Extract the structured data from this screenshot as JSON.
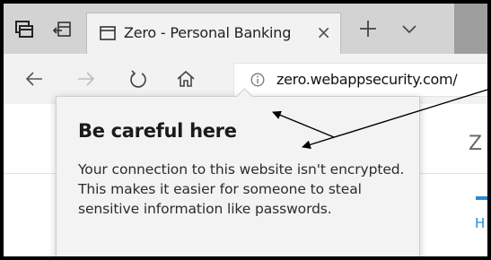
{
  "tab": {
    "title": "Zero - Personal Banking",
    "close_glyph": "×"
  },
  "address_bar": {
    "url": "zero.webappsecurity.com/"
  },
  "popover": {
    "title": "Be careful here",
    "body": "Your connection to this website isn't encrypted. This makes it easier for someone to steal sensitive information like passwords."
  },
  "page": {
    "heading_fragment": "Z",
    "link_fragment": "H"
  },
  "icons": {
    "tab_actions": "tab-actions-icon",
    "set_aside_tabs": "set-aside-tabs-icon",
    "tab_favicon": "page-icon",
    "new_tab": "plus-icon",
    "tab_list": "chevron-down-icon",
    "back": "back-arrow-icon",
    "forward": "forward-arrow-icon",
    "refresh": "refresh-icon",
    "home": "home-icon",
    "site_info": "info-icon"
  },
  "colors": {
    "titlebar_bg": "#d3d3d3",
    "tab_bg": "#f2f2f2",
    "popover_bg": "#f3f3f3",
    "page_accent": "#2a8ad4",
    "frame_border": "#000000"
  }
}
